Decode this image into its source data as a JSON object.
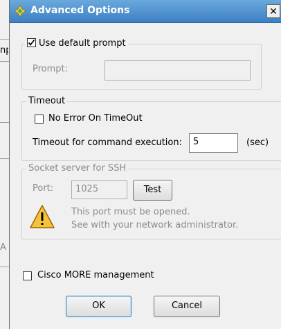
{
  "background": {
    "tab_fragment_1": "np",
    "tab_fragment_2": "A"
  },
  "dialog": {
    "title": "Advanced Options",
    "close_glyph": "✕"
  },
  "prompt_group": {
    "use_default_label": "Use default prompt",
    "use_default_checked": true,
    "prompt_label": "Prompt:",
    "prompt_value": ""
  },
  "timeout_group": {
    "legend": "Timeout",
    "no_error_label": "No Error On TimeOut",
    "no_error_checked": false,
    "timeout_label": "Timeout for command execution:",
    "timeout_value": "5",
    "unit": "(sec)"
  },
  "socket_group": {
    "legend": "Socket server for SSH",
    "port_label": "Port:",
    "port_value": "1025",
    "test_label": "Test",
    "warning_icon": "warning-icon",
    "warning_line1": "This port must be opened.",
    "warning_line2": "See with your network administrator."
  },
  "cisco": {
    "label": "Cisco MORE management",
    "checked": false
  },
  "buttons": {
    "ok": "OK",
    "cancel": "Cancel"
  },
  "colors": {
    "title_bar": "#3d80c4",
    "disabled_text": "#8c8c8c"
  }
}
